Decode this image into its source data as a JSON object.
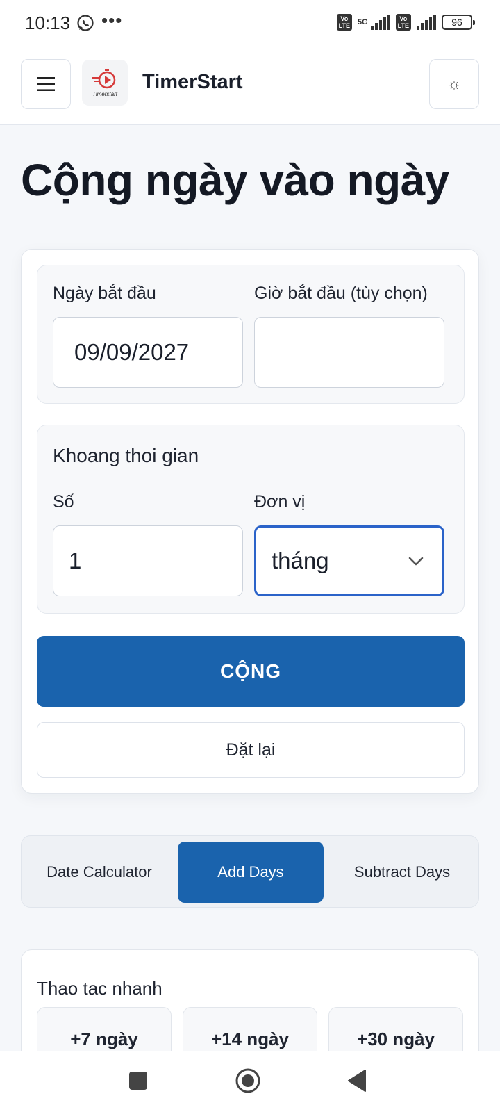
{
  "status_bar": {
    "time": "10:13",
    "network": "5G",
    "volte_label": "Vo\nLTE",
    "battery": "96"
  },
  "header": {
    "logo_text": "Timerstart",
    "app_title": "TimerStart"
  },
  "page": {
    "title": "Cộng ngày vào ngày"
  },
  "form": {
    "start_date_label": "Ngày bắt đầu",
    "start_date_value": "09/09/2027",
    "start_time_label": "Giờ bắt đầu (tùy chọn)",
    "start_time_value": "",
    "interval_title": "Khoang thoi gian",
    "number_label": "Số",
    "number_value": "1",
    "unit_label": "Đơn vị",
    "unit_value": "tháng",
    "submit_label": "CỘNG",
    "reset_label": "Đặt lại"
  },
  "tabs": [
    {
      "label": "Date Calculator",
      "active": false
    },
    {
      "label": "Add Days",
      "active": true
    },
    {
      "label": "Subtract Days",
      "active": false
    }
  ],
  "quick_actions": {
    "title": "Thao tac nhanh",
    "buttons": [
      "+7 ngày",
      "+14 ngày",
      "+30 ngày"
    ]
  },
  "colors": {
    "primary": "#1a63ad",
    "focus_border": "#2b63c9",
    "logo_accent": "#d63a3a"
  }
}
